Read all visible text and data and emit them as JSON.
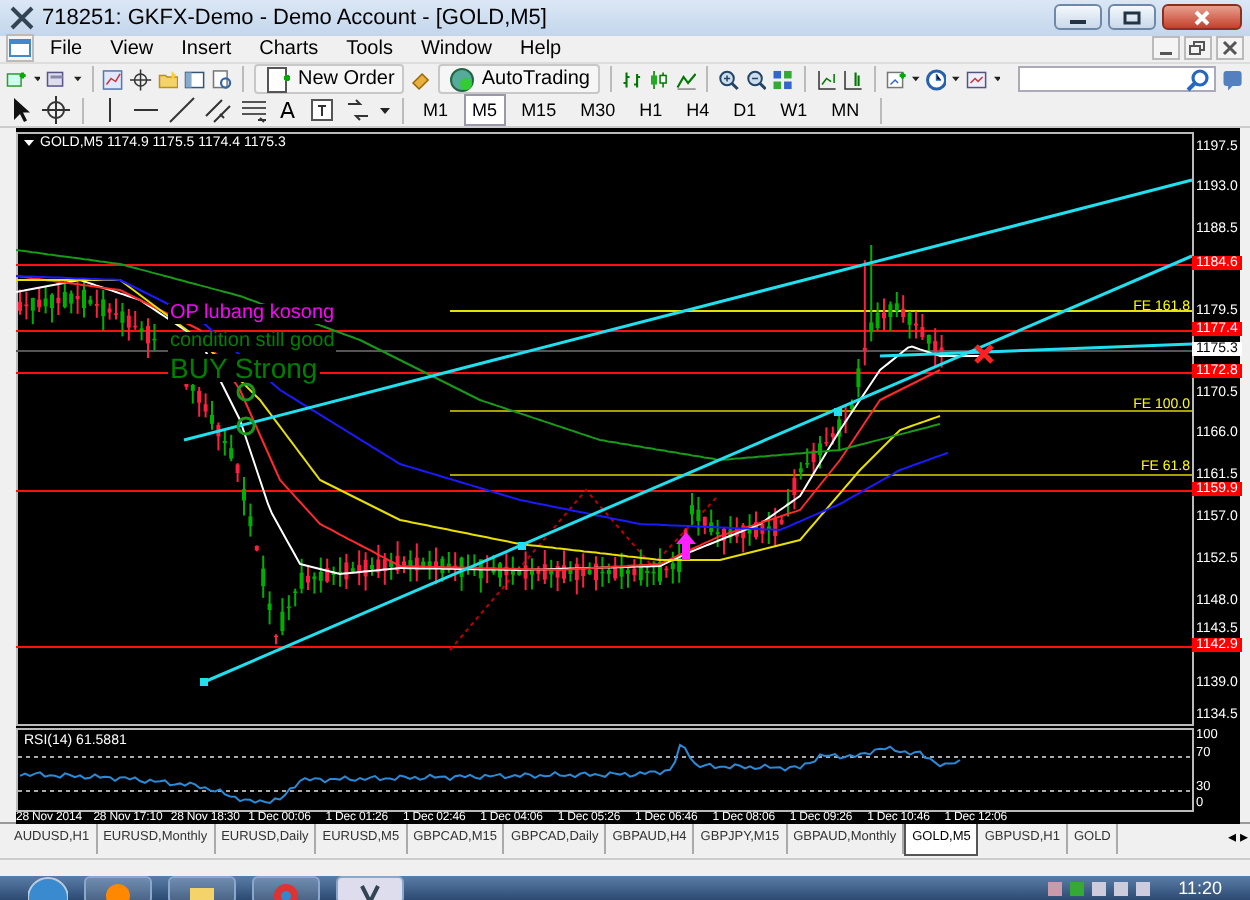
{
  "window": {
    "title": "718251: GKFX-Demo - Demo Account - [GOLD,M5]"
  },
  "menu": [
    "File",
    "View",
    "Insert",
    "Charts",
    "Tools",
    "Window",
    "Help"
  ],
  "toolbar": {
    "new_order": "New Order",
    "autotrading": "AutoTrading",
    "text_tool": "A"
  },
  "periods": [
    {
      "label": "M1",
      "selected": false
    },
    {
      "label": "M5",
      "selected": true
    },
    {
      "label": "M15",
      "selected": false
    },
    {
      "label": "M30",
      "selected": false
    },
    {
      "label": "H1",
      "selected": false
    },
    {
      "label": "H4",
      "selected": false
    },
    {
      "label": "D1",
      "selected": false
    },
    {
      "label": "W1",
      "selected": false
    },
    {
      "label": "MN",
      "selected": false
    }
  ],
  "chart": {
    "symbol_label": "GOLD,M5 1174.9 1175.5 1174.4 1175.3",
    "annotations": [
      {
        "text": "OP lubang kosong",
        "color": "#ff00ff",
        "kind": "note"
      },
      {
        "text": "condition still good",
        "color": "#008000",
        "kind": "note"
      },
      {
        "text": "BUY Strong",
        "color": "#008000",
        "kind": "signal"
      }
    ],
    "fibo_labels": [
      "FE 161.8",
      "FE 100.0",
      "FE 61.8"
    ],
    "price_ticks": [
      "1197.5",
      "1193.0",
      "1188.5",
      "1179.5",
      "1170.5",
      "1166.0",
      "1161.5",
      "1157.0",
      "1152.5",
      "1148.0",
      "1143.5",
      "1139.0",
      "1134.5"
    ],
    "price_markers": [
      {
        "text": "1184.6",
        "kind": "level"
      },
      {
        "text": "1177.4",
        "kind": "level"
      },
      {
        "text": "1175.3",
        "kind": "current"
      },
      {
        "text": "1172.8",
        "kind": "level"
      },
      {
        "text": "1159.9",
        "kind": "level"
      },
      {
        "text": "1142.9",
        "kind": "level"
      }
    ],
    "rsi": {
      "label": "RSI(14) 61.5881",
      "ticks": [
        "100",
        "70",
        "30",
        "0"
      ]
    },
    "time_labels": [
      "28 Nov 2014",
      "28 Nov 17:10",
      "28 Nov 18:30",
      "1 Dec 00:06",
      "1 Dec 01:26",
      "1 Dec 02:46",
      "1 Dec 04:06",
      "1 Dec 05:26",
      "1 Dec 06:46",
      "1 Dec 08:06",
      "1 Dec 09:26",
      "1 Dec 10:46",
      "1 Dec 12:06"
    ]
  },
  "tabs": [
    {
      "label": "AUDUSD,H1",
      "selected": false
    },
    {
      "label": "EURUSD,Monthly",
      "selected": false
    },
    {
      "label": "EURUSD,Daily",
      "selected": false
    },
    {
      "label": "EURUSD,M5",
      "selected": false
    },
    {
      "label": "GBPCAD,M15",
      "selected": false
    },
    {
      "label": "GBPCAD,Daily",
      "selected": false
    },
    {
      "label": "GBPAUD,H4",
      "selected": false
    },
    {
      "label": "GBPJPY,M15",
      "selected": false
    },
    {
      "label": "GBPAUD,Monthly",
      "selected": false
    },
    {
      "label": "GOLD,M5",
      "selected": true
    },
    {
      "label": "GBPUSD,H1",
      "selected": false
    },
    {
      "label": "GOLD",
      "selected": false
    }
  ],
  "tab_arrows": [
    "◂",
    "▸"
  ],
  "taskbar": {
    "clock": "11:20"
  }
}
